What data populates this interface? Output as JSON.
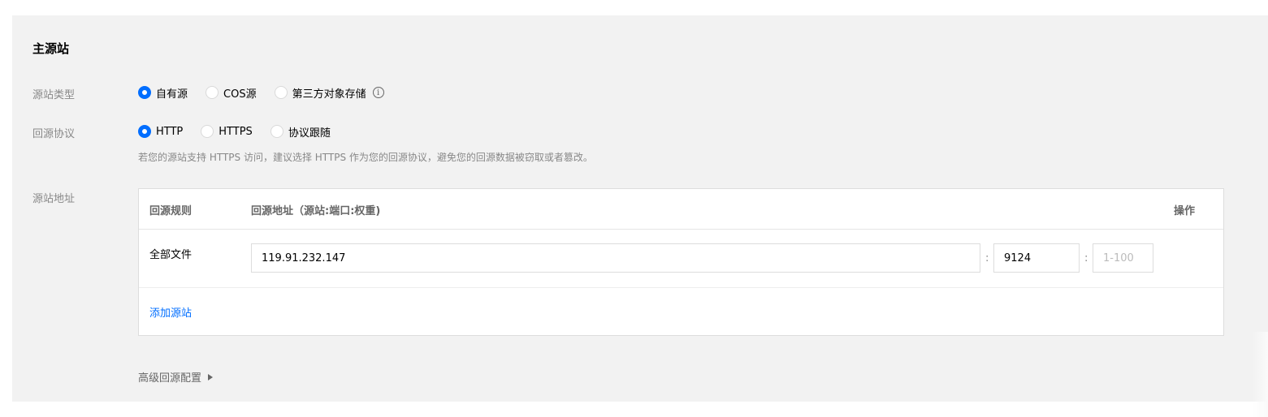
{
  "section": {
    "title": "主源站"
  },
  "origin_type": {
    "label": "源站类型",
    "options": [
      {
        "label": "自有源",
        "checked": true
      },
      {
        "label": "COS源",
        "checked": false
      },
      {
        "label": "第三方对象存储",
        "checked": false
      }
    ],
    "info_icon": "info-icon"
  },
  "protocol": {
    "label": "回源协议",
    "options": [
      {
        "label": "HTTP",
        "checked": true
      },
      {
        "label": "HTTPS",
        "checked": false
      },
      {
        "label": "协议跟随",
        "checked": false
      }
    ],
    "hint": "若您的源站支持 HTTPS 访问，建议选择 HTTPS 作为您的回源协议，避免您的回源数据被窃取或者篡改。"
  },
  "origin_address": {
    "label": "源站地址",
    "columns": [
      "回源规则",
      "回源地址（源站:端口:权重)",
      "操作"
    ],
    "rows": [
      {
        "rule": "全部文件",
        "address": "119.91.232.147",
        "port": "9124",
        "weight_placeholder": "1-100"
      }
    ],
    "separator": ":",
    "add_link": "添加源站"
  },
  "advanced": {
    "label": "高级回源配置"
  },
  "colors": {
    "accent": "#006eff",
    "panel_bg": "#f2f2f2",
    "label_gray": "#888888"
  }
}
